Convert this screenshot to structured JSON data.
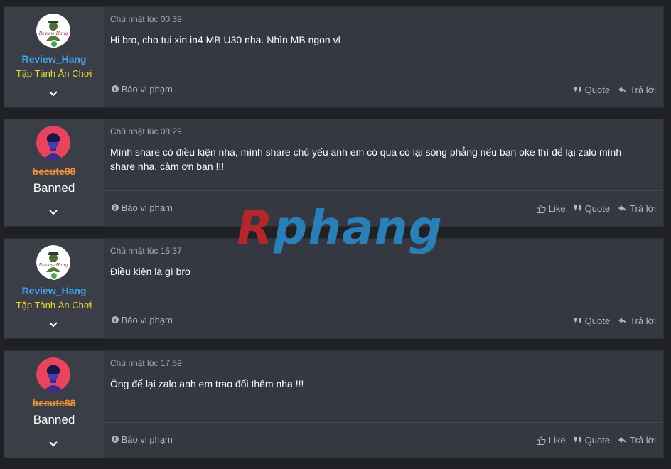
{
  "posts": [
    {
      "user": {
        "name": "Review_Hang",
        "title": "Tập Tành Ăn Chơi",
        "banned": false,
        "online": true
      },
      "date": "Chủ nhật lúc 00:39",
      "message": "Hi bro, cho tui xin in4 MB U30 nha. Nhìn MB ngon vl",
      "actions": {
        "report": "Báo vi phạm",
        "quote": "Quote",
        "reply": "Trả lời"
      }
    },
    {
      "user": {
        "name": "becute88",
        "title": "Banned",
        "banned": true,
        "online": false
      },
      "date": "Chủ nhật lúc 08:29",
      "message": "Mình share có điều kiện nha, mình share chủ yếu anh em có qua có lại sòng phẳng nếu bạn oke thì để lại zalo mình share nha, cảm ơn bạn !!!",
      "actions": {
        "report": "Báo vi phạm",
        "like": "Like",
        "quote": "Quote",
        "reply": "Trả lời"
      }
    },
    {
      "user": {
        "name": "Review_Hang",
        "title": "Tập Tành Ăn Chơi",
        "banned": false,
        "online": true
      },
      "date": "Chủ nhật lúc 15:37",
      "message": "Điều kiện là gì bro",
      "actions": {
        "report": "Báo vi phạm",
        "quote": "Quote",
        "reply": "Trả lời"
      }
    },
    {
      "user": {
        "name": "becute88",
        "title": "Banned",
        "banned": true,
        "online": false
      },
      "date": "Chủ nhật lúc 17:59",
      "message": "Ông để lại zalo anh em trao đổi thêm nha !!!",
      "actions": {
        "report": "Báo vi phạm",
        "like": "Like",
        "quote": "Quote",
        "reply": "Trả lời"
      }
    }
  ],
  "watermark": {
    "first": "R",
    "rest": "phang"
  },
  "icons": {
    "report": "info-circle-icon",
    "like": "thumbs-up-icon",
    "quote": "quote-icon",
    "reply": "reply-arrow-icon",
    "expand": "chevron-down-icon",
    "online": "online-status-icon"
  },
  "colors": {
    "username": "#3fa4ea",
    "banned_username": "#e8903a",
    "user_title": "#e6dc2e",
    "online": "#45a84b",
    "background": "#1f2125",
    "post_bg": "#353840"
  }
}
